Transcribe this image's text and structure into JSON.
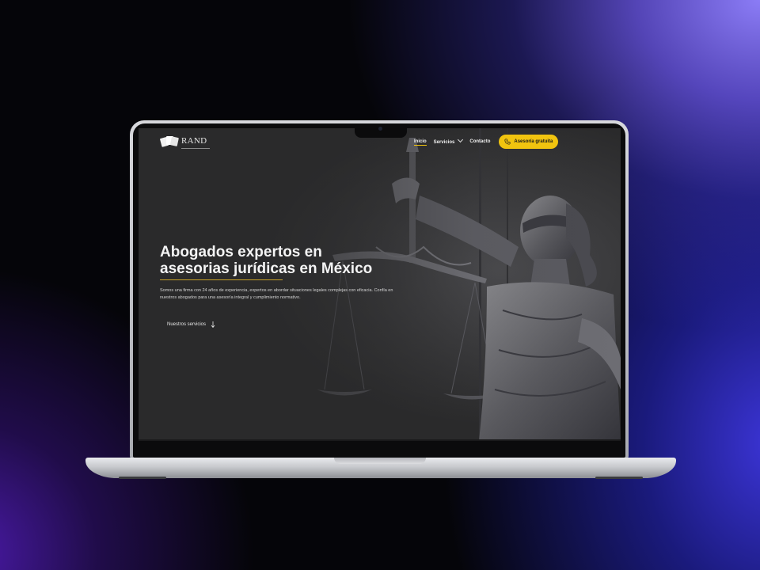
{
  "brand": {
    "name": "RAND",
    "accent_color": "#f1c40f",
    "logo_icon": "cards-logo-icon"
  },
  "nav": {
    "items": [
      {
        "label": "Inicio",
        "active": true
      },
      {
        "label": "Servicios",
        "has_dropdown": true
      },
      {
        "label": "Contacto"
      }
    ],
    "cta_label": "Asesoría gratuita",
    "cta_icon": "phone-icon"
  },
  "hero": {
    "title_line1": "Abogados expertos en",
    "title_line2": "asesorias jurídicas en México",
    "description": "Somos una firma con 24 años de experiencia, expertos en abordar situaciones legales complejas con eficacia. Confía en nuestros abogados para una asesoría integral y cumplimiento normativo.",
    "link_label": "Nuestros servicios",
    "link_icon": "arrow-down-icon",
    "image": "lady-justice-statue"
  }
}
